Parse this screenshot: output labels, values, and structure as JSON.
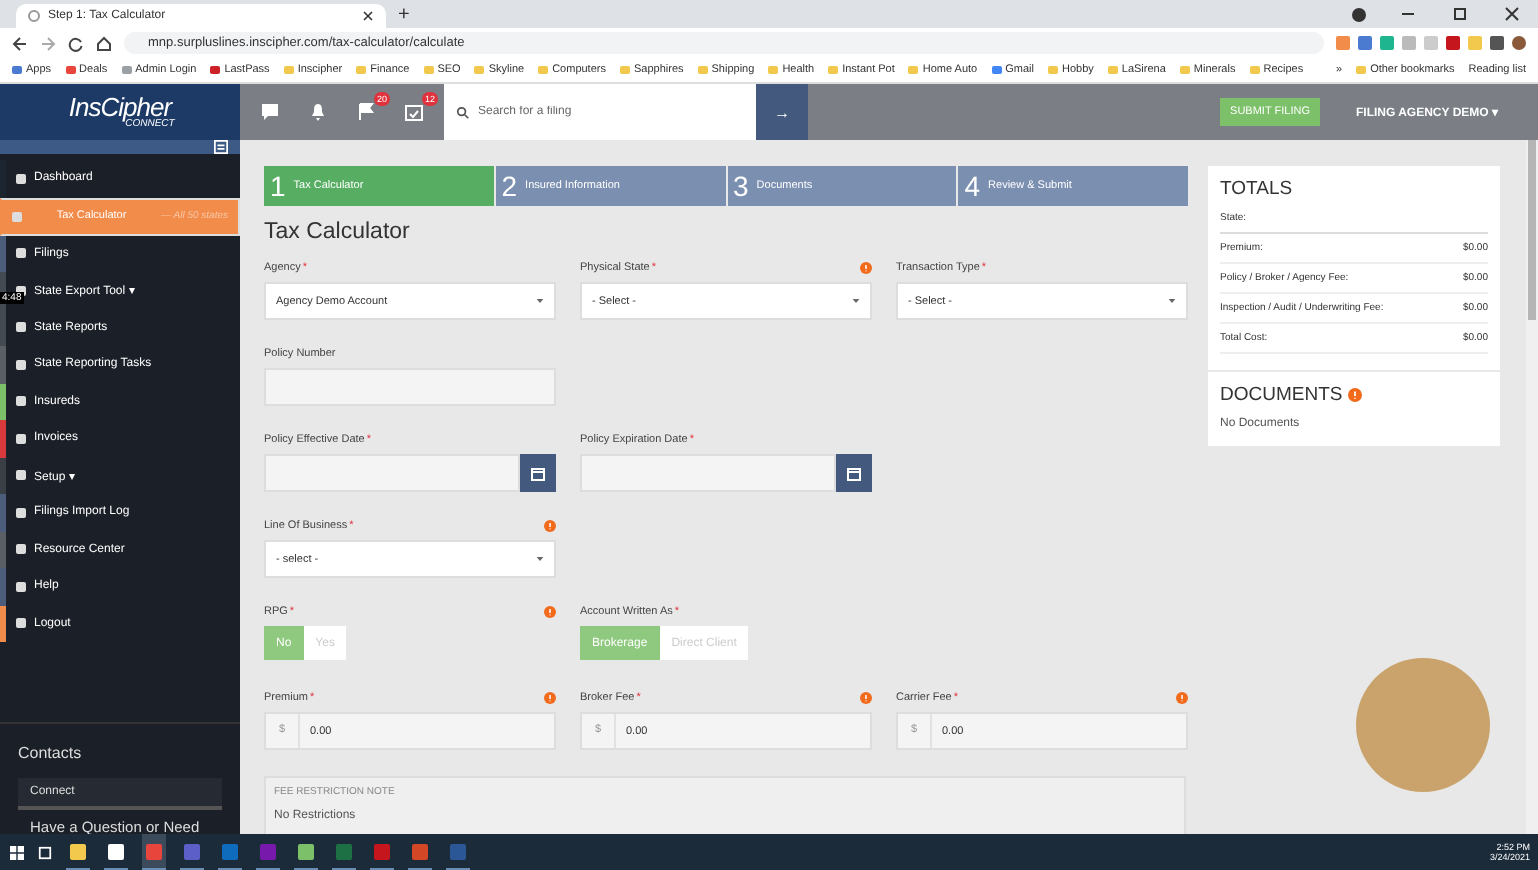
{
  "browser": {
    "tab_title": "Step 1: Tax Calculator",
    "new_tab": "+",
    "url": "mnp.surpluslines.inscipher.com/tax-calculator/calculate",
    "bookmarks": [
      {
        "label": "Apps",
        "color": "#4a7bd0"
      },
      {
        "label": "Deals",
        "color": "#e8453c"
      },
      {
        "label": "Admin Login",
        "color": "#9aa0a6"
      },
      {
        "label": "LastPass",
        "color": "#cc2127"
      },
      {
        "label": "Inscipher",
        "color": "#f2c94c"
      },
      {
        "label": "Finance",
        "color": "#f2c94c"
      },
      {
        "label": "SEO",
        "color": "#f2c94c"
      },
      {
        "label": "Skyline",
        "color": "#f2c94c"
      },
      {
        "label": "Computers",
        "color": "#f2c94c"
      },
      {
        "label": "Sapphires",
        "color": "#f2c94c"
      },
      {
        "label": "Shipping",
        "color": "#f2c94c"
      },
      {
        "label": "Health",
        "color": "#f2c94c"
      },
      {
        "label": "Instant Pot",
        "color": "#f2c94c"
      },
      {
        "label": "Home Auto",
        "color": "#f2c94c"
      },
      {
        "label": "Gmail",
        "color": "#4285f4"
      },
      {
        "label": "Hobby",
        "color": "#f2c94c"
      },
      {
        "label": "LaSirena",
        "color": "#f2c94c"
      },
      {
        "label": "Minerals",
        "color": "#f2c94c"
      },
      {
        "label": "Recipes",
        "color": "#f2c94c"
      }
    ],
    "more": "»",
    "other_bookmarks": "Other bookmarks",
    "reading_list": "Reading list"
  },
  "header": {
    "logo": "InsCipher",
    "logo_sub": "CONNECT",
    "flag_badge": "20",
    "task_badge": "12",
    "search": {
      "placeholder": "Search for a filing"
    },
    "go": "→",
    "submit": "SUBMIT FILING",
    "agency": "FILING AGENCY DEMO ▾"
  },
  "sidebar": {
    "items": [
      {
        "label": "Dashboard",
        "selected": false,
        "color": "#1c2430"
      },
      {
        "label": "Tax Calculator",
        "hint": "— All 50 states",
        "selected": true,
        "color": "#f28c4b"
      },
      {
        "label": "Filings",
        "selected": false,
        "color": "#4b5d7a"
      },
      {
        "label": "State Export Tool ▾",
        "selected": false,
        "color": "#444a52"
      },
      {
        "label": "State Reports",
        "selected": false,
        "color": "#444a52"
      },
      {
        "label": "State Reporting Tasks",
        "selected": false,
        "color": "#5a5f66"
      },
      {
        "label": "Insureds",
        "selected": false,
        "color": "#7cc06a"
      },
      {
        "label": "Invoices",
        "selected": false,
        "color": "#d9393b"
      },
      {
        "label": "Setup ▾",
        "selected": false,
        "color": "#3a3f46"
      },
      {
        "label": "Filings Import Log",
        "selected": false,
        "color": "#4b5d7a"
      },
      {
        "label": "Resource Center",
        "selected": false,
        "color": "#5a5f66"
      },
      {
        "label": "Help",
        "selected": false,
        "color": "#4b5d7a"
      },
      {
        "label": "Logout",
        "selected": false,
        "color": "#f28c4b"
      }
    ],
    "video_time": "4:48",
    "contacts_title": "Contacts",
    "contacts_tab": "Connect",
    "contacts_text": "Have a Question or Need"
  },
  "steps": [
    {
      "number": "1",
      "label": "Tax Calculator",
      "selected": true
    },
    {
      "number": "2",
      "label": "Insured Information",
      "selected": false
    },
    {
      "number": "3",
      "label": "Documents",
      "selected": false
    },
    {
      "number": "4",
      "label": "Review & Submit",
      "selected": false
    }
  ],
  "page_title": "Tax Calculator",
  "form": {
    "rows": [
      [
        {
          "label": "Agency",
          "required_mark": "*",
          "kind": "select",
          "value": "Agency Demo Account"
        },
        {
          "label": "Physical State",
          "required_mark": "*",
          "info": true,
          "kind": "select",
          "value": "- Select -"
        },
        {
          "label": "Transaction Type",
          "required_mark": "*",
          "kind": "select",
          "value": "- Select -"
        }
      ],
      [
        {
          "label": "Policy Number",
          "kind": "input"
        }
      ],
      [
        {
          "label": "Policy Effective Date",
          "required_mark": "*",
          "kind": "date"
        },
        {
          "label": "Policy Expiration Date",
          "required_mark": "*",
          "kind": "date"
        }
      ],
      [
        {
          "label": "Line Of Business",
          "required_mark": "*",
          "info": true,
          "kind": "select",
          "value": "- select -"
        }
      ],
      [
        {
          "label": "RPG",
          "required_mark": "*",
          "info": true,
          "kind": "toggle",
          "options": [
            {
              "label": "No",
              "selected": true
            },
            {
              "label": "Yes",
              "selected": false
            }
          ]
        },
        {
          "label": "Account Written As",
          "required_mark": "*",
          "kind": "toggle",
          "options": [
            {
              "label": "Brokerage",
              "selected": true
            },
            {
              "label": "Direct Client",
              "selected": false
            }
          ]
        }
      ],
      [
        {
          "label": "Premium",
          "required_mark": "*",
          "info": true,
          "kind": "money",
          "prefix": "$",
          "value": "0.00"
        },
        {
          "label": "Broker Fee",
          "required_mark": "*",
          "info": true,
          "kind": "money",
          "prefix": "$",
          "value": "0.00"
        },
        {
          "label": "Carrier Fee",
          "required_mark": "*",
          "info": true,
          "kind": "money",
          "prefix": "$",
          "value": "0.00"
        }
      ]
    ],
    "note": {
      "title": "FEE RESTRICTION NOTE",
      "text": "No Restrictions"
    }
  },
  "totals": {
    "title": "TOTALS",
    "state_label": "State:",
    "rows": [
      {
        "label": "Premium:",
        "value": "$0.00"
      },
      {
        "label": "Policy / Broker / Agency Fee:",
        "value": "$0.00"
      },
      {
        "label": "Inspection / Audit / Underwriting Fee:",
        "value": "$0.00"
      },
      {
        "label": "Total Cost:",
        "value": "$0.00"
      }
    ]
  },
  "documents": {
    "title": "DOCUMENTS",
    "text": "No Documents"
  },
  "taskbar": {
    "apps": [
      {
        "color": "#f2c94c",
        "selected": false
      },
      {
        "color": "#ffffff",
        "selected": false
      },
      {
        "color": "#e8453c",
        "selected": true
      },
      {
        "color": "#5b5fc7",
        "selected": false
      },
      {
        "color": "#0f6cbd",
        "selected": false
      },
      {
        "color": "#7719aa",
        "selected": false
      },
      {
        "color": "#7cc06a",
        "selected": false
      },
      {
        "color": "#1d7044",
        "selected": false
      },
      {
        "color": "#c4161c",
        "selected": false
      },
      {
        "color": "#d24726",
        "selected": false
      },
      {
        "color": "#2b5797",
        "selected": false
      }
    ],
    "time": "2:52 PM",
    "date": "3/24/2021"
  }
}
